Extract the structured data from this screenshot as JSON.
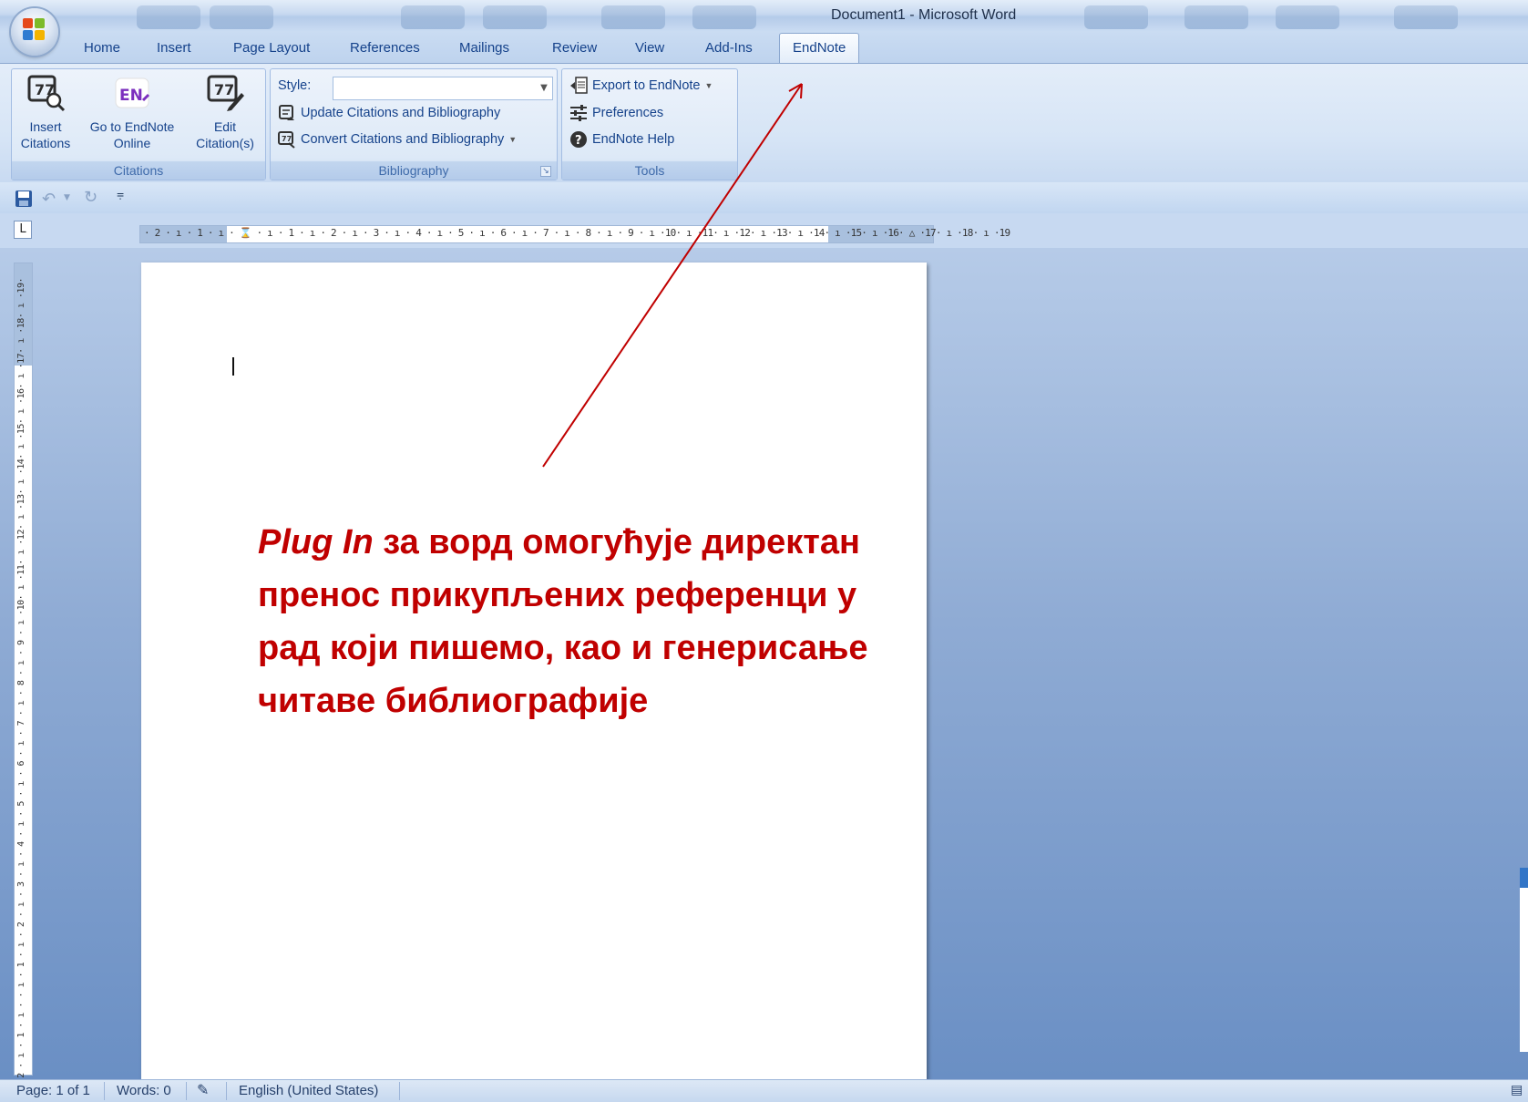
{
  "window": {
    "title": "Document1 - Microsoft Word"
  },
  "tabs": [
    {
      "label": "Home"
    },
    {
      "label": "Insert"
    },
    {
      "label": "Page Layout"
    },
    {
      "label": "References"
    },
    {
      "label": "Mailings"
    },
    {
      "label": "Review"
    },
    {
      "label": "View"
    },
    {
      "label": "Add-Ins"
    },
    {
      "label": "EndNote",
      "active": true
    }
  ],
  "ribbon": {
    "citations": {
      "label": "Citations",
      "insert_line1": "Insert",
      "insert_line2": "Citations",
      "goto_line1": "Go to EndNote",
      "goto_line2": "Online",
      "edit_line1": "Edit",
      "edit_line2": "Citation(s)",
      "en_logo": "EN"
    },
    "bibliography": {
      "label": "Bibliography",
      "style_label": "Style:",
      "style_value": "",
      "update": "Update Citations and Bibliography",
      "convert": "Convert Citations and Bibliography"
    },
    "tools": {
      "label": "Tools",
      "export": "Export to EndNote",
      "preferences": "Preferences",
      "help": "EndNote Help"
    }
  },
  "ruler": {
    "horizontal": "· 2 · ı · 1 · ı · ⌛ · ı · 1 · ı · 2 · ı · 3 · ı · 4 · ı · 5 · ı · 6 · ı · 7 · ı · 8 · ı · 9 · ı ·10· ı ·11· ı ·12· ı ·13· ı ·14· ı ·15· ı ·16· △ ·17· ı ·18· ı ·19",
    "vertical": "· 2 · ı · 1 · ı · · ı · 1 · ı · 2 · ı · 3 · ı · 4 · ı · 5 · ı · 6 · ı · 7 · ı · 8 · ı · 9 · ı ·10· ı ·11· ı ·12· ı ·13· ı ·14· ı ·15· ı ·16· ı ·17· ı ·18· ı ·19·",
    "tab_selector": "L"
  },
  "annotation": {
    "italic": "Plug In",
    "rest": " за ворд омогућује директан пренос прикупљених референци у рад који пишемо, као и генерисање читаве библиографије"
  },
  "statusbar": {
    "page": "Page: 1 of 1",
    "words": "Words: 0",
    "language": "English (United States)"
  },
  "colors": {
    "annotation": "#c00000",
    "ribbon_text": "#15428b",
    "en_logo": "#7b2fbe"
  }
}
